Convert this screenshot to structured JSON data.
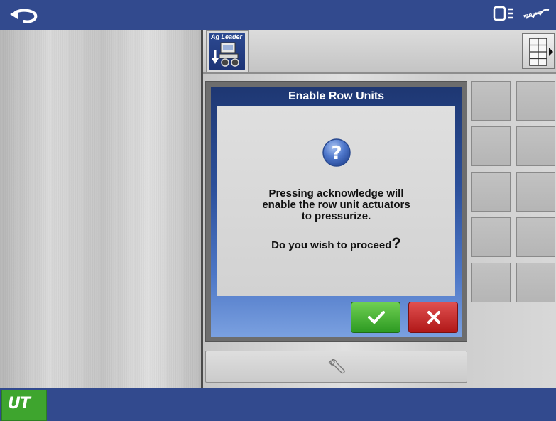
{
  "topbar": {
    "back_icon": "undo-arrow-icon",
    "display_icon": "display-status-icon",
    "signal_icon": "signal-strength-icon"
  },
  "tabs": {
    "aglead_label": "Ag Leader",
    "aglead_icon": "planter-implement-icon",
    "grid_icon": "grid-menu-icon"
  },
  "dialog": {
    "title": "Enable Row Units",
    "icon": "question-icon",
    "message_lines": [
      "Pressing acknowledge will",
      "enable the row unit actuators",
      "to pressurize."
    ],
    "question": "Do you wish to proceed",
    "question_mark": "?",
    "ok_icon": "checkmark-icon",
    "cancel_icon": "x-icon"
  },
  "toolbar": {
    "wrench_icon": "wrench-icon"
  },
  "bottombar": {
    "ut_label": "UT"
  },
  "colors": {
    "bar_blue": "#324a8e",
    "ok_green": "#3fae2e",
    "cancel_red": "#c42020",
    "ut_green": "#3ea52e"
  }
}
